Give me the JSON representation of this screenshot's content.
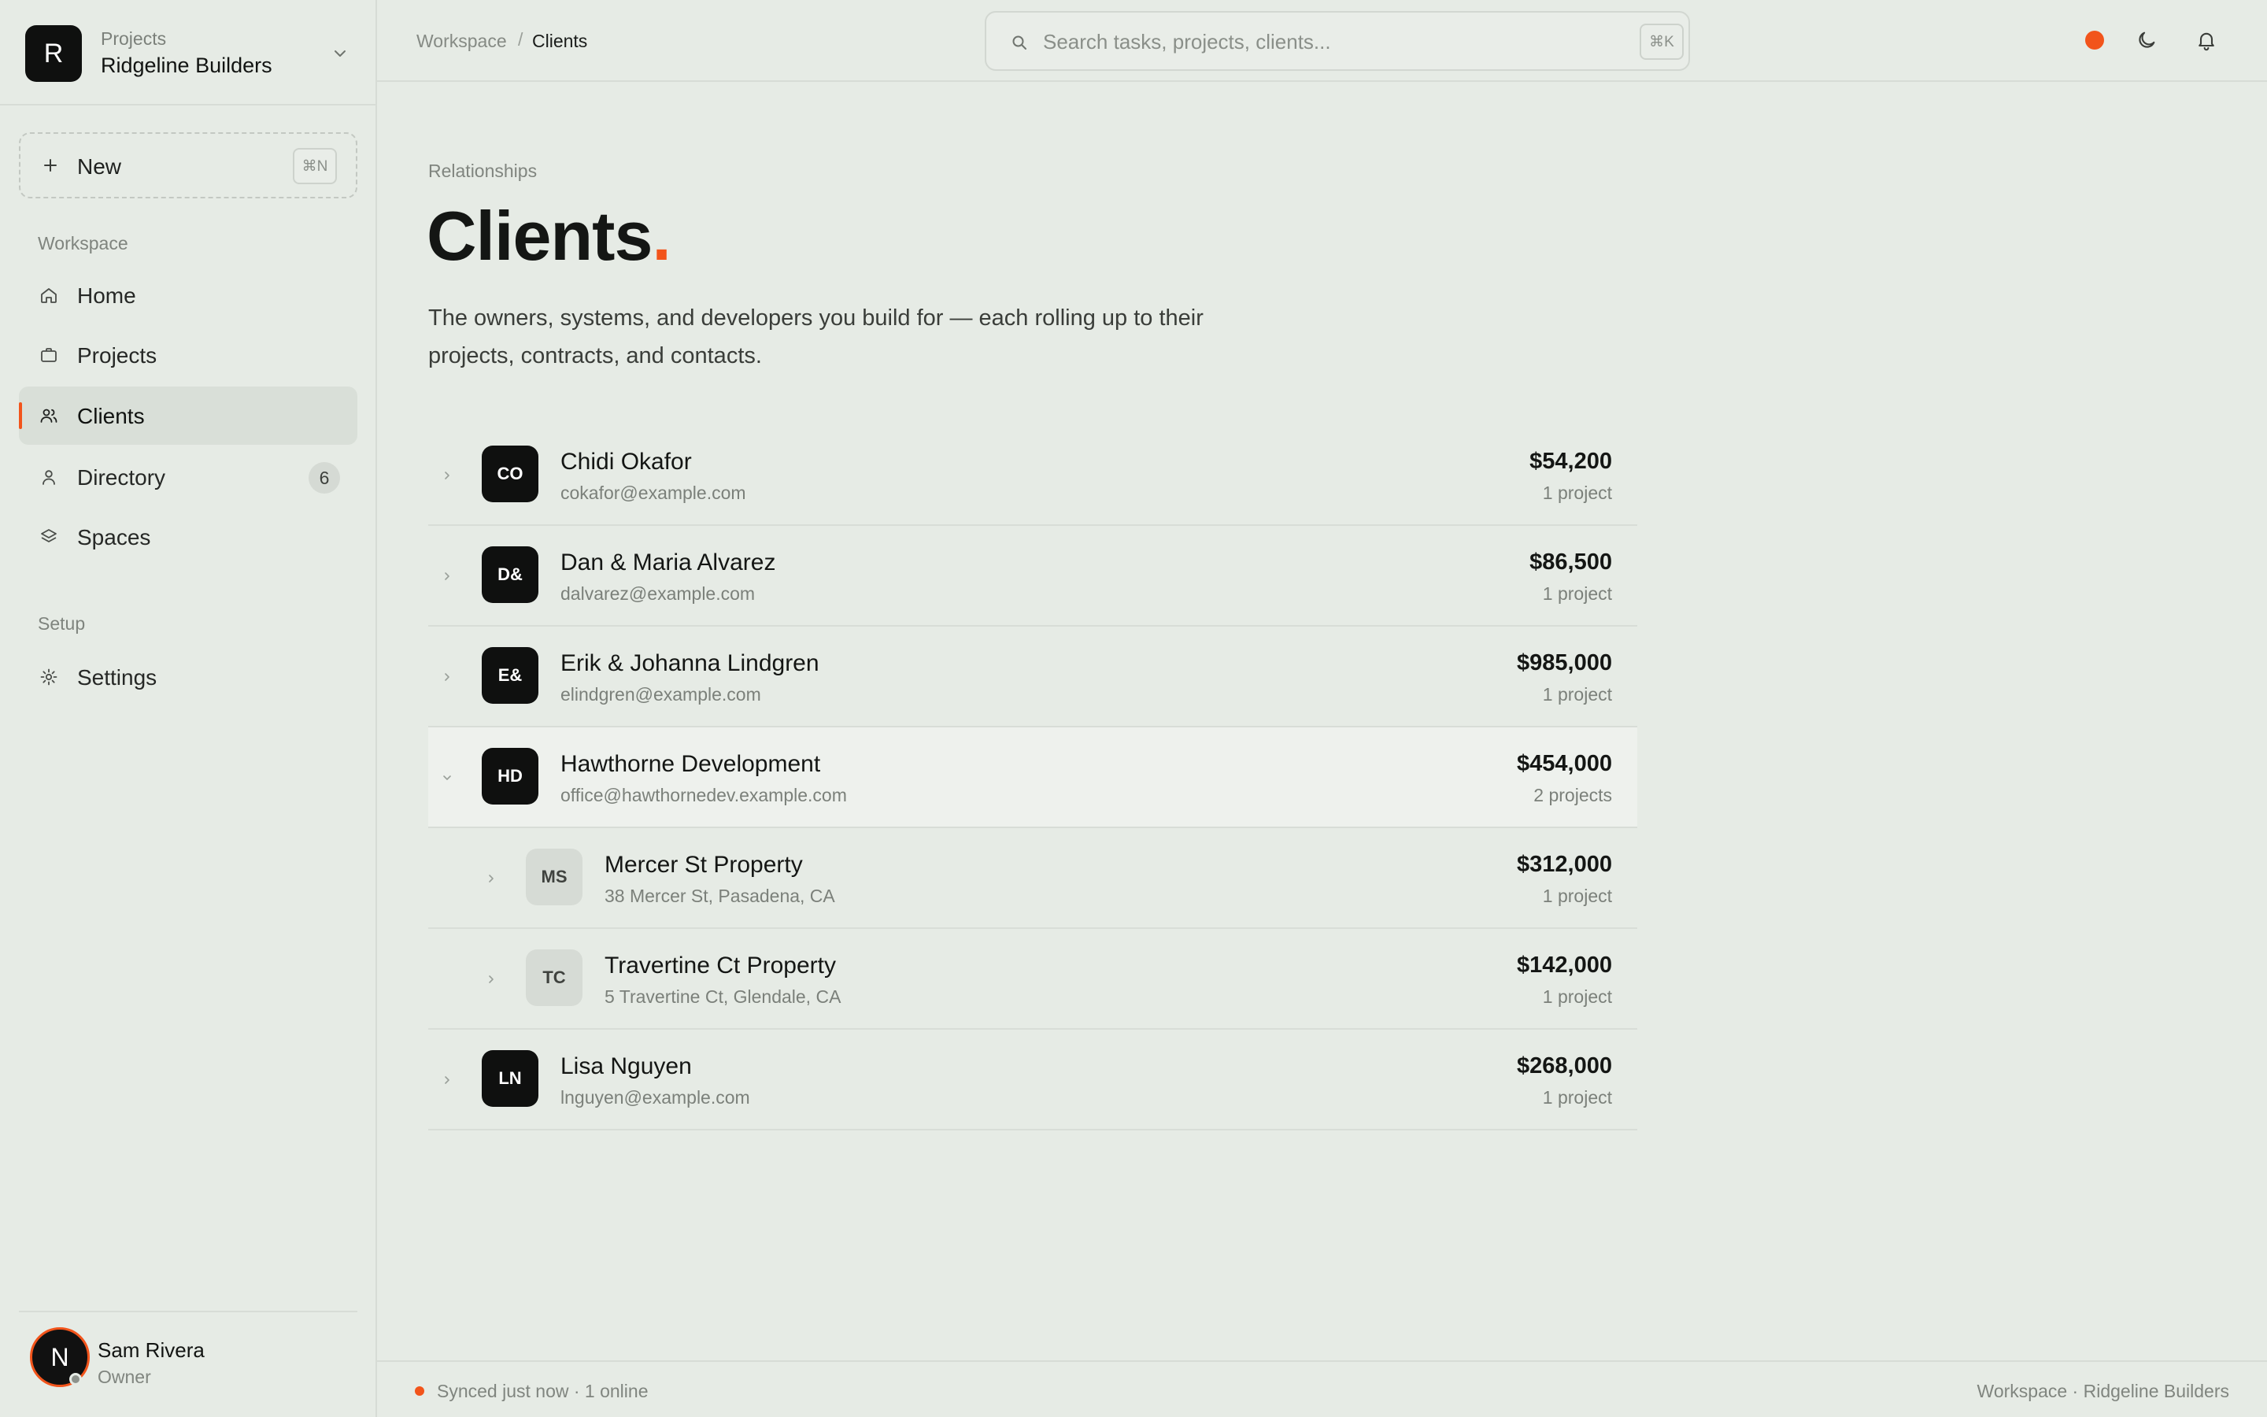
{
  "org": {
    "initial": "R",
    "kicker": "Projects",
    "name": "Ridgeline Builders"
  },
  "new_button": {
    "label": "New",
    "shortcut": "⌘N"
  },
  "sidebar": {
    "workspace_label": "Workspace",
    "setup_label": "Setup",
    "items": [
      {
        "label": "Home",
        "icon": "home-icon"
      },
      {
        "label": "Projects",
        "icon": "briefcase-icon"
      },
      {
        "label": "Clients",
        "icon": "users-icon",
        "active": true
      },
      {
        "label": "Directory",
        "icon": "person-icon",
        "badge": "6"
      },
      {
        "label": "Spaces",
        "icon": "layers-icon"
      }
    ],
    "setup_items": [
      {
        "label": "Settings",
        "icon": "gear-icon"
      }
    ]
  },
  "user": {
    "initial": "N",
    "name": "Sam Rivera",
    "role": "Owner"
  },
  "breadcrumb": {
    "root": "Workspace",
    "separator": "/",
    "current": "Clients"
  },
  "search": {
    "placeholder": "Search tasks, projects, clients...",
    "shortcut": "⌘K"
  },
  "page": {
    "kicker": "Relationships",
    "title": "Clients",
    "title_dot": ".",
    "subtitle": "The owners, systems, and developers you build for — each rolling up to their projects, contracts, and contacts."
  },
  "clients": [
    {
      "initials": "CO",
      "name": "Chidi Okafor",
      "sub": "cokafor@example.com",
      "amount": "$54,200",
      "count": "1 project",
      "level": 0,
      "expanded": false
    },
    {
      "initials": "D&",
      "name": "Dan & Maria Alvarez",
      "sub": "dalvarez@example.com",
      "amount": "$86,500",
      "count": "1 project",
      "level": 0,
      "expanded": false
    },
    {
      "initials": "E&",
      "name": "Erik & Johanna Lindgren",
      "sub": "elindgren@example.com",
      "amount": "$985,000",
      "count": "1 project",
      "level": 0,
      "expanded": false
    },
    {
      "initials": "HD",
      "name": "Hawthorne Development",
      "sub": "office@hawthornedev.example.com",
      "amount": "$454,000",
      "count": "2 projects",
      "level": 0,
      "expanded": true
    },
    {
      "initials": "MS",
      "name": "Mercer St Property",
      "sub": "38 Mercer St, Pasadena, CA",
      "amount": "$312,000",
      "count": "1 project",
      "level": 1,
      "expanded": false
    },
    {
      "initials": "TC",
      "name": "Travertine Ct Property",
      "sub": "5 Travertine Ct, Glendale, CA",
      "amount": "$142,000",
      "count": "1 project",
      "level": 1,
      "expanded": false
    },
    {
      "initials": "LN",
      "name": "Lisa Nguyen",
      "sub": "lnguyen@example.com",
      "amount": "$268,000",
      "count": "1 project",
      "level": 0,
      "expanded": false
    }
  ],
  "footer": {
    "status": "Synced just now · 1 online",
    "context": "Workspace · Ridgeline Builders"
  },
  "colors": {
    "accent": "#f2541b",
    "background": "#e6ebe5",
    "ink": "#0f100f"
  }
}
